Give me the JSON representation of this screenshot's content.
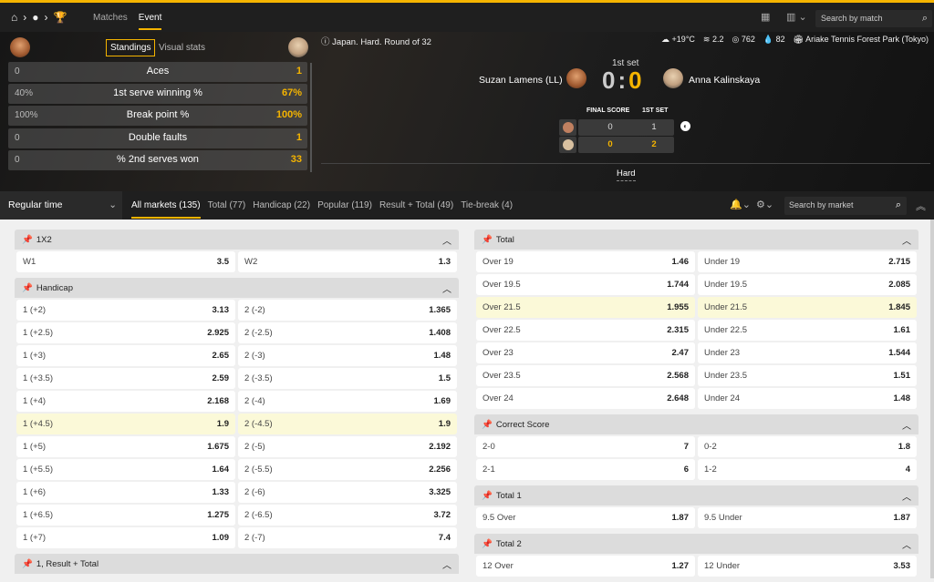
{
  "topbar": {
    "nav_tabs": [
      "Matches",
      "Event"
    ],
    "search_placeholder": "Search by match"
  },
  "standings": {
    "tab_standings": "Standings",
    "tab_visual": "Visual stats",
    "rows": [
      {
        "left": "0",
        "label": "Aces",
        "right": "1"
      },
      {
        "left": "40%",
        "label": "1st serve winning %",
        "right": "67%"
      },
      {
        "left": "100%",
        "label": "Break point %",
        "right": "100%"
      },
      {
        "left": "0",
        "label": "Double faults",
        "right": "1"
      },
      {
        "left": "0",
        "label": "% 2nd serves won",
        "right": "33"
      }
    ]
  },
  "match": {
    "info": "Japan. Hard. Round of 32",
    "temp": "+19°C",
    "wind": "2.2",
    "pressure": "762",
    "humidity": "82",
    "venue": "Ariake Tennis Forest Park (Tokyo)",
    "set_label": "1st set",
    "player1": "Suzan Lamens (LL)",
    "player2": "Anna Kalinskaya",
    "score1": "0",
    "score_sep": ":",
    "score2": "0",
    "final_score_label": "FINAL SCORE",
    "first_set_label": "1ST SET",
    "p1_final": "0",
    "p1_set": "1",
    "p2_final": "0",
    "p2_set": "2",
    "surface": "Hard"
  },
  "markets_bar": {
    "period": "Regular time",
    "tabs": [
      "All markets (135)",
      "Total (77)",
      "Handicap (22)",
      "Popular (119)",
      "Result + Total (49)",
      "Tie-break (4)"
    ],
    "search_placeholder": "Search by market"
  },
  "left_markets": [
    {
      "title": "1X2",
      "rows": [
        [
          {
            "n": "W1",
            "o": "3.5"
          },
          {
            "n": "W2",
            "o": "1.3"
          }
        ]
      ]
    },
    {
      "title": "Handicap",
      "rows": [
        [
          {
            "n": "1 (+2)",
            "o": "3.13"
          },
          {
            "n": "2 (-2)",
            "o": "1.365"
          }
        ],
        [
          {
            "n": "1 (+2.5)",
            "o": "2.925"
          },
          {
            "n": "2 (-2.5)",
            "o": "1.408"
          }
        ],
        [
          {
            "n": "1 (+3)",
            "o": "2.65"
          },
          {
            "n": "2 (-3)",
            "o": "1.48"
          }
        ],
        [
          {
            "n": "1 (+3.5)",
            "o": "2.59"
          },
          {
            "n": "2 (-3.5)",
            "o": "1.5"
          }
        ],
        [
          {
            "n": "1 (+4)",
            "o": "2.168"
          },
          {
            "n": "2 (-4)",
            "o": "1.69"
          }
        ],
        [
          {
            "n": "1 (+4.5)",
            "o": "1.9",
            "hl": true
          },
          {
            "n": "2 (-4.5)",
            "o": "1.9",
            "hl": true
          }
        ],
        [
          {
            "n": "1 (+5)",
            "o": "1.675"
          },
          {
            "n": "2 (-5)",
            "o": "2.192"
          }
        ],
        [
          {
            "n": "1 (+5.5)",
            "o": "1.64"
          },
          {
            "n": "2 (-5.5)",
            "o": "2.256"
          }
        ],
        [
          {
            "n": "1 (+6)",
            "o": "1.33"
          },
          {
            "n": "2 (-6)",
            "o": "3.325"
          }
        ],
        [
          {
            "n": "1 (+6.5)",
            "o": "1.275"
          },
          {
            "n": "2 (-6.5)",
            "o": "3.72"
          }
        ],
        [
          {
            "n": "1 (+7)",
            "o": "1.09"
          },
          {
            "n": "2 (-7)",
            "o": "7.4"
          }
        ]
      ]
    },
    {
      "title": "1, Result + Total",
      "rows": []
    }
  ],
  "right_markets": [
    {
      "title": "Total",
      "rows": [
        [
          {
            "n": "Over 19",
            "o": "1.46"
          },
          {
            "n": "Under 19",
            "o": "2.715"
          }
        ],
        [
          {
            "n": "Over 19.5",
            "o": "1.744"
          },
          {
            "n": "Under 19.5",
            "o": "2.085"
          }
        ],
        [
          {
            "n": "Over 21.5",
            "o": "1.955",
            "hl": true
          },
          {
            "n": "Under 21.5",
            "o": "1.845",
            "hl": true
          }
        ],
        [
          {
            "n": "Over 22.5",
            "o": "2.315"
          },
          {
            "n": "Under 22.5",
            "o": "1.61"
          }
        ],
        [
          {
            "n": "Over 23",
            "o": "2.47"
          },
          {
            "n": "Under 23",
            "o": "1.544"
          }
        ],
        [
          {
            "n": "Over 23.5",
            "o": "2.568"
          },
          {
            "n": "Under 23.5",
            "o": "1.51"
          }
        ],
        [
          {
            "n": "Over 24",
            "o": "2.648"
          },
          {
            "n": "Under 24",
            "o": "1.48"
          }
        ]
      ]
    },
    {
      "title": "Correct Score",
      "rows": [
        [
          {
            "n": "2-0",
            "o": "7"
          },
          {
            "n": "0-2",
            "o": "1.8"
          }
        ],
        [
          {
            "n": "2-1",
            "o": "6"
          },
          {
            "n": "1-2",
            "o": "4"
          }
        ]
      ]
    },
    {
      "title": "Total 1",
      "rows": [
        [
          {
            "n": "9.5 Over",
            "o": "1.87"
          },
          {
            "n": "9.5 Under",
            "o": "1.87"
          }
        ]
      ]
    },
    {
      "title": "Total 2",
      "rows": [
        [
          {
            "n": "12 Over",
            "o": "1.27"
          },
          {
            "n": "12 Under",
            "o": "3.53"
          }
        ]
      ]
    }
  ],
  "colors": {
    "accent": "#f5b400",
    "highlight_row": "#fbf9d8"
  }
}
